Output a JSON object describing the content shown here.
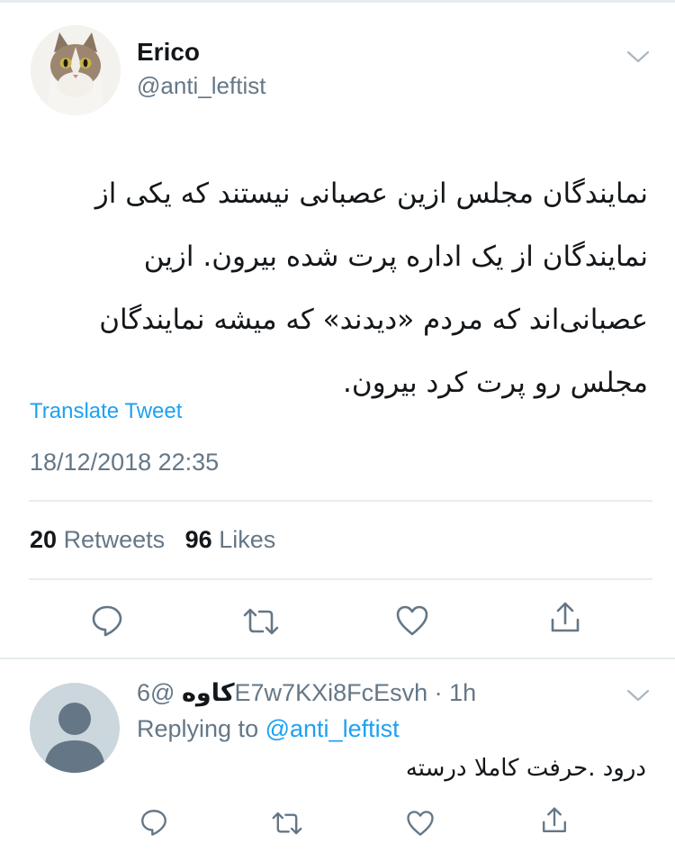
{
  "tweet": {
    "display_name": "Erico",
    "handle": "@anti_leftist",
    "text": "نمایندگان مجلس ازین عصبانی نیستند که یکی از نمایندگان از یک اداره پرت شده بیرون. ازین عصبانی‌اند که مردم «دیدند» که میشه نمایندگان مجلس رو پرت کرد بیرون.",
    "translate_label": "Translate Tweet",
    "timestamp": "18/12/2018 22:35",
    "retweet_count": "20",
    "retweet_label": "Retweets",
    "like_count": "96",
    "like_label": "Likes"
  },
  "actions": [
    "reply-icon",
    "retweet-icon",
    "like-icon",
    "share-icon"
  ],
  "reply": {
    "display_name": "کاوه",
    "handle_time": "@6E7w7KXi8FcEsvh · 1h",
    "replying_label": "Replying to",
    "replying_to": "@anti_leftist",
    "text": "درود .حرفت کاملا درسته"
  },
  "colors": {
    "accent": "#1da1f2",
    "secondary_text": "#657786",
    "divider": "#e6ecf0",
    "icon": "#657786"
  }
}
